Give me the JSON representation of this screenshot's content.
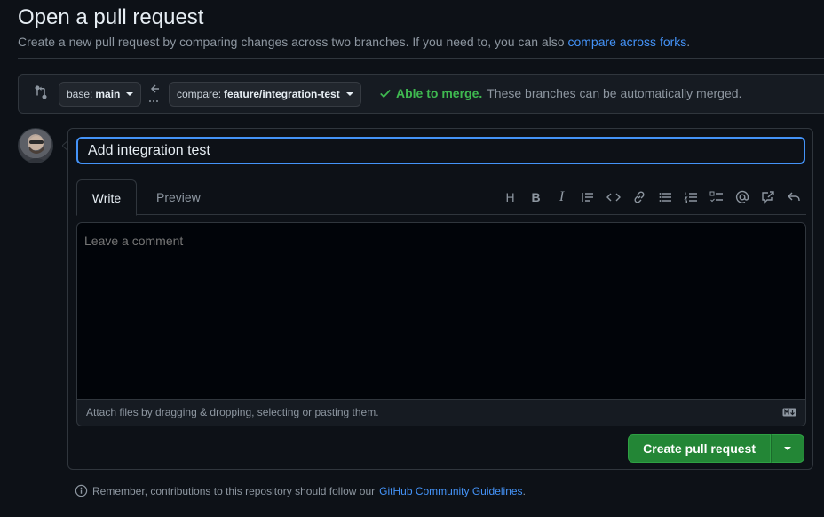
{
  "header": {
    "title": "Open a pull request",
    "subtitle": "Create a new pull request by comparing changes across two branches. If you need to, you can also",
    "subtitle_link": "compare across forks",
    "subtitle_end": "."
  },
  "compare": {
    "base_label": "base:",
    "base_value": "main",
    "compare_label": "compare:",
    "compare_value": "feature/integration-test",
    "merge_ok": "Able to merge.",
    "merge_text": "These branches can be automatically merged."
  },
  "form": {
    "title_value": "Add integration test",
    "tabs": {
      "write": "Write",
      "preview": "Preview"
    },
    "toolbar": {
      "heading": "H",
      "bold": "B",
      "italic": "I"
    },
    "comment_placeholder": "Leave a comment",
    "attach_text": "Attach files by dragging & dropping, selecting or pasting them.",
    "submit_label": "Create pull request"
  },
  "footer": {
    "text": "Remember, contributions to this repository should follow our",
    "link": "GitHub Community Guidelines",
    "end": "."
  },
  "colors": {
    "background": "#0d1117",
    "accent_blue": "#4493f8",
    "success_green": "#3fb950",
    "button_green": "#238636",
    "muted": "#8d96a0"
  }
}
